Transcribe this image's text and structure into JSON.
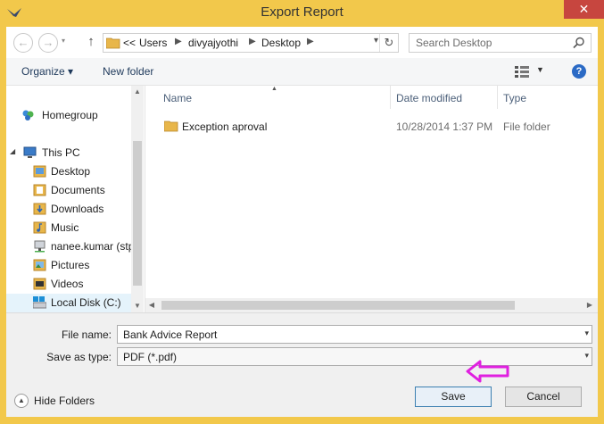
{
  "window": {
    "title": "Export Report",
    "close_glyph": "✕"
  },
  "nav": {
    "back_glyph": "←",
    "forward_glyph": "→",
    "up_glyph": "↑",
    "address": {
      "overflow": "<<",
      "parts": [
        "Users",
        "divyajyothi",
        "Desktop"
      ]
    },
    "refresh_glyph": "↻",
    "search_placeholder": "Search Desktop"
  },
  "toolbar": {
    "organize_label": "Organize ▾",
    "new_folder_label": "New folder",
    "help_glyph": "?"
  },
  "sidebar": {
    "items": [
      {
        "label": "Homegroup",
        "icon": "homegroup-icon"
      },
      {
        "label": "This PC",
        "icon": "computer-icon"
      },
      {
        "label": "Desktop",
        "icon": "folder-icon"
      },
      {
        "label": "Documents",
        "icon": "documents-icon"
      },
      {
        "label": "Downloads",
        "icon": "downloads-icon"
      },
      {
        "label": "Music",
        "icon": "music-icon"
      },
      {
        "label": "nanee.kumar (stp",
        "icon": "network-drive-icon"
      },
      {
        "label": "Pictures",
        "icon": "pictures-icon"
      },
      {
        "label": "Videos",
        "icon": "videos-icon"
      },
      {
        "label": "Local Disk (C:)",
        "icon": "disk-icon"
      }
    ]
  },
  "files": {
    "columns": {
      "name": "Name",
      "date": "Date modified",
      "type": "Type"
    },
    "rows": [
      {
        "name": "Exception aproval",
        "date": "10/28/2014 1:37 PM",
        "type": "File folder"
      }
    ]
  },
  "form": {
    "filename_label": "File name:",
    "filename_value": "Bank Advice Report",
    "type_label": "Save as type:",
    "type_value": "PDF (*.pdf)"
  },
  "footer": {
    "hide_folders_label": "Hide Folders",
    "save_label": "Save",
    "cancel_label": "Cancel"
  },
  "colors": {
    "frame": "#f2c84b",
    "close": "#c7463f",
    "annotation_arrow": "#e020e0",
    "link": "#1e395b"
  }
}
